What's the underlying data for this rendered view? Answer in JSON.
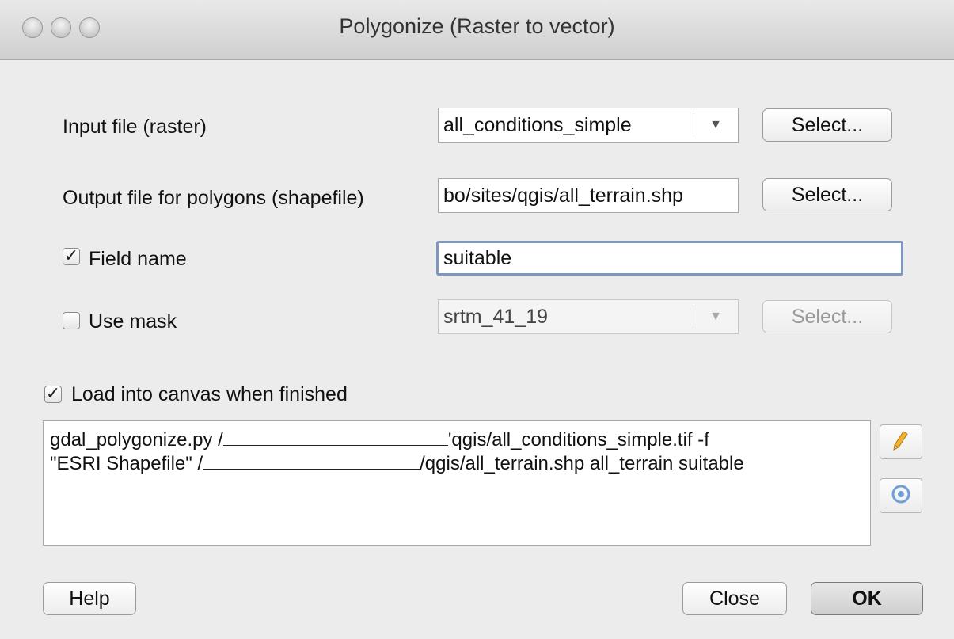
{
  "window": {
    "title": "Polygonize (Raster to vector)"
  },
  "input_raster": {
    "label": "Input file (raster)",
    "value": "all_conditions_simple",
    "select_label": "Select..."
  },
  "output_polygons": {
    "label": "Output file for polygons (shapefile)",
    "value": "bo/sites/qgis/all_terrain.shp",
    "select_label": "Select..."
  },
  "field_name": {
    "label": "Field name",
    "checked": true,
    "value": "suitable"
  },
  "use_mask": {
    "label": "Use mask",
    "checked": false,
    "value": "srtm_41_19",
    "select_label": "Select..."
  },
  "load_canvas": {
    "label": "Load into canvas when finished",
    "checked": true
  },
  "command": {
    "line1_a": "gdal_polygonize.py /",
    "line1_b": "'qgis/all_conditions_simple.tif -f",
    "line2_a": "\"ESRI Shapefile\" /",
    "line2_b": "/qgis/all_terrain.shp all_terrain suitable"
  },
  "buttons": {
    "help": "Help",
    "close": "Close",
    "ok": "OK"
  },
  "icons": {
    "edit": "pencil-icon",
    "reset": "reset-icon"
  }
}
